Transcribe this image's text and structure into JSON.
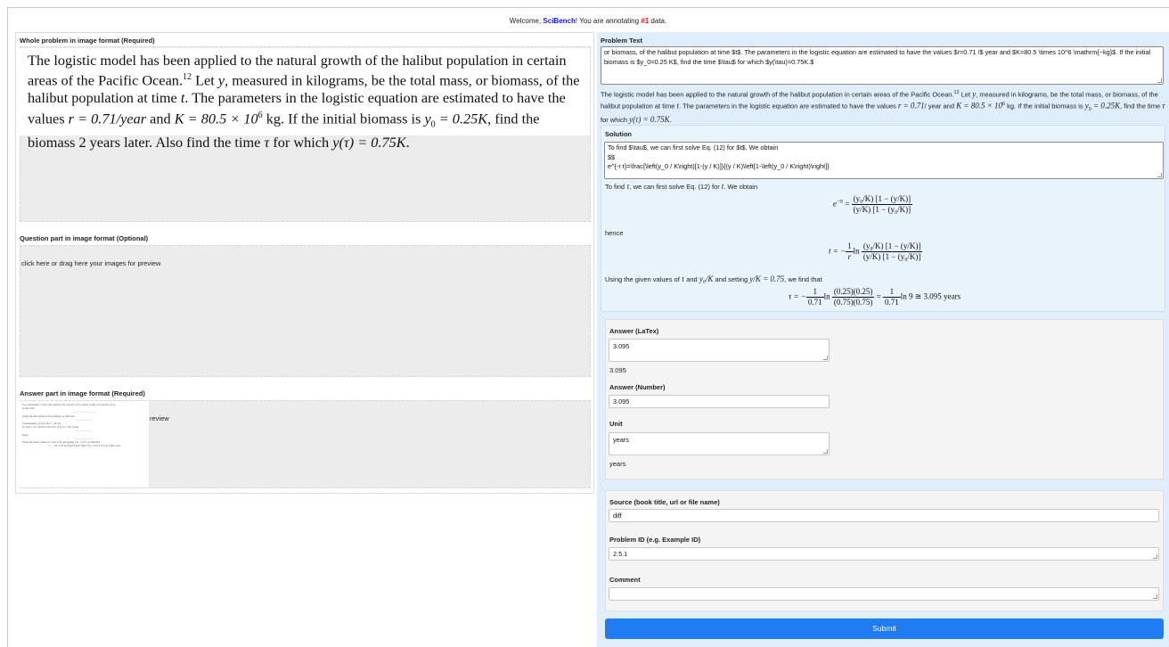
{
  "header": {
    "welcome_prefix": "Welcome, ",
    "user": "SciBench",
    "welcome_mid": "! You are annotating ",
    "count": "#1",
    "welcome_suffix": " data."
  },
  "left": {
    "whole_problem_title": "Whole problem in image format (Required)",
    "problem_text_1": "The logistic model has been applied to the natural growth of the halibut population in certain areas of the Pacific Ocean.",
    "problem_footnote": "12",
    "problem_text_2": " Let ",
    "problem_var_y": "y",
    "problem_text_3": ", measured in kilograms, be the total mass, or biomass, of the halibut population at time ",
    "problem_var_t": "t",
    "problem_text_4": ". The parameters in the logistic equation are estimated to have the values ",
    "problem_r": "r = 0.71/year",
    "problem_and": " and ",
    "problem_K": "K = 80.5 × 10",
    "problem_K_exp": "6",
    "problem_K_unit": " kg. If the initial biomass is ",
    "problem_y0": "y",
    "problem_y0_sub": "0",
    "problem_y0_val": " = 0.25K",
    "problem_text_5": ", find the biomass 2 years later. Also find the time ",
    "problem_tau": "τ",
    "problem_text_6": " for which ",
    "problem_ytau": "y(τ) = 0.75K",
    "problem_end": ".",
    "question_title": "Question part in image format (Optional)",
    "question_drop_text": "click here or drag here your images for preview",
    "answer_title": "Answer part in image format (Required)",
    "answer_drop_text": "review"
  },
  "right": {
    "problem_text_title": "Problem Text",
    "problem_text_value": "or biomass, of the halibut population at time $t$. The parameters in the logistic equation are estimated to have the values $r=0.71 /$ year and $K=80.5 \\times 10^6 \\mathrm{~kg}$. If the initial biomass is $y_0=0.25 K$, find the time $\\tau$ for which $y(\\tau)=0.75K.$",
    "rendered_1": "The logistic model has been applied to the natural growth of the halibut population in certain areas of the Pacific Ocean.",
    "rendered_fn": "12",
    "rendered_2": " Let ",
    "rendered_y": "y",
    "rendered_3": ", measured in kilograms, be the total mass, or biomass, of the halibut population at time ",
    "rendered_t": "t",
    "rendered_4": ". The parameters in the logistic equation are estimated to have the values ",
    "rendered_r": "r = 0.71",
    "rendered_5": "/ year and ",
    "rendered_K": "K = 80.5 × 10",
    "rendered_K_exp": "6",
    "rendered_6": " kg. If the initial biomass is ",
    "rendered_y0": "y",
    "rendered_y0_sub": "0",
    "rendered_y0_val": " = 0.25K",
    "rendered_7": ", find the time ",
    "rendered_tau": "τ",
    "rendered_8": " for which ",
    "rendered_ytau": "y(τ) = 0.75K",
    "rendered_end": ".",
    "solution_title": "Solution",
    "solution_value_1": "To find $\\tau$, we can first solve Eq. (12) for $t$. We obtain",
    "solution_value_2": "$$",
    "solution_value_3": "e^{-r t}=\\frac{\\left(y_0 / K\\right)[1-(y / K)]}{(y / K)\\left[1-\\left(y_0 / K\\right)\\right]}",
    "sol_r1_a": "To find ",
    "sol_r1_tau": "τ",
    "sol_r1_b": ", we can first solve Eq. (12) for ",
    "sol_r1_t": "t",
    "sol_r1_c": ". We obtain",
    "eq1_lhs": "e",
    "eq1_lhs_exp": "−rt",
    "eq1_eq": " = ",
    "eq1_num": "(y₀/K) [1 − (y/K)]",
    "eq1_den": "(y/K) [1 − (y₀/K)]",
    "hence": "hence",
    "eq2_lhs": "t = −",
    "eq2_one": "1",
    "eq2_r": "r",
    "eq2_ln": "ln",
    "eq2_num": "(y₀/K) [1 − (y/K)]",
    "eq2_den": "(y/K) [1 − (y₀/K)]",
    "sol_r3_a": "Using the given values of ",
    "sol_r3_tau": "τ",
    "sol_r3_b": " and ",
    "sol_r3_y0": "y₀/K",
    "sol_r3_c": " and setting ",
    "sol_r3_yk": "y/K = 0.75",
    "sol_r3_d": ", we find that",
    "eq3_lhs": "τ = −",
    "eq3_one": "1",
    "eq3_071": "0.71",
    "eq3_ln": "ln",
    "eq3_num": "(0.25)(0.25)",
    "eq3_den": "(0.75)(0.75)",
    "eq3_eq": " = ",
    "eq3_one_b": "1",
    "eq3_071_b": "0.71",
    "eq3_tail": "ln 9 ≅ 3.095 years",
    "answer_latex_label": "Answer (LaTex)",
    "answer_latex_value": "3.095",
    "answer_latex_rendered": "3.095",
    "answer_number_label": "Answer (Number)",
    "answer_number_value": "3.095",
    "unit_label": "Unit",
    "unit_value": "years",
    "unit_rendered": "years",
    "source_label": "Source (book title, url or file name)",
    "source_value": "diff",
    "problem_id_label": "Problem ID (e.g. Example ID)",
    "problem_id_value": "2.5.1",
    "comment_label": "Comment",
    "comment_value": "",
    "submit_label": "Submit"
  },
  "thumbnail": {
    "line1": "It is convenient to write the solution of (1) in the yet ly equity of this we write Eq. (11)",
    "line2": "in the form",
    "line3": "Using the data given in the problem, we find that",
    "line4": "Consequently, y(2) ≅ 46.7 × 10⁶ kg.",
    "line5": "To find τ, we can first solve Eq. (12) for t. We obtain",
    "line6": "hence",
    "line7": "Using the given values of τ and y₀/K and setting y/K = 0.75, we find that",
    "line8": "τ = − 1/0.71 ln (0.25)(0.25)/(0.75)(0.75) = 1/0.71 ln 9 ≅ 3.095 years"
  },
  "colors": {
    "user_name": "#1a1ae6",
    "count": "#e0161e",
    "submit_bg": "#1f7cf3",
    "right_panel_bg": "#dfeefa"
  }
}
